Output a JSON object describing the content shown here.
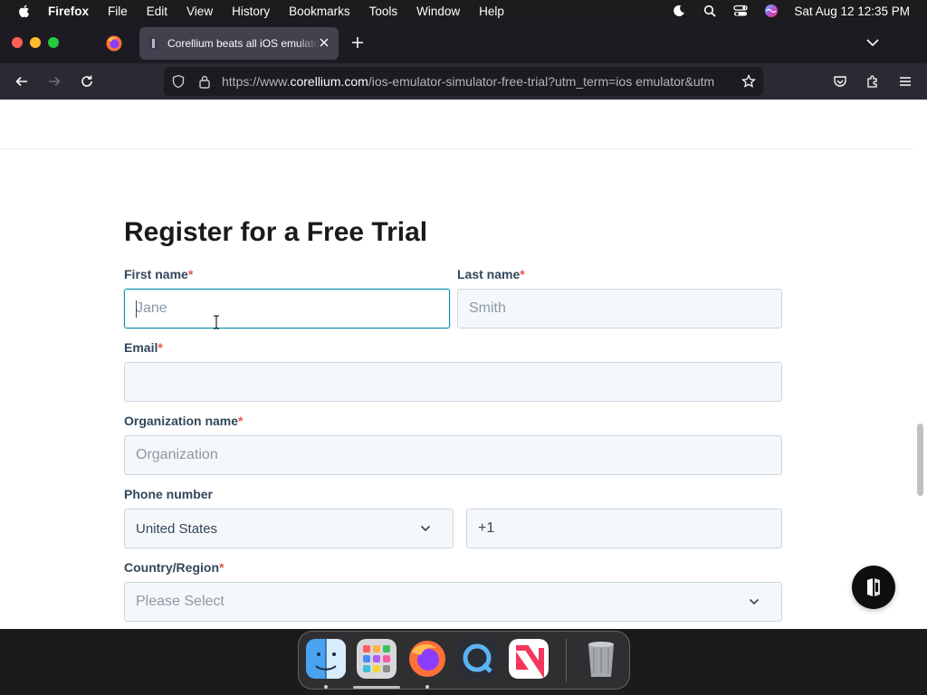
{
  "menubar": {
    "app_name": "Firefox",
    "items": [
      "File",
      "Edit",
      "View",
      "History",
      "Bookmarks",
      "Tools",
      "Window",
      "Help"
    ],
    "clock": "Sat Aug 12  12:35 PM"
  },
  "browser": {
    "tab_title": "Corellium beats all iOS emulators",
    "url_prefix": "https://www.",
    "url_host": "corellium.com",
    "url_path": "/ios-emulator-simulator-free-trial?utm_term=ios emulator&utm"
  },
  "form": {
    "title": "Register for a Free Trial",
    "first_name": {
      "label": "First name",
      "required_mark": "*",
      "placeholder": "Jane"
    },
    "last_name": {
      "label": "Last name",
      "required_mark": "*",
      "placeholder": "Smith"
    },
    "email": {
      "label": "Email",
      "required_mark": "*",
      "placeholder": ""
    },
    "organization": {
      "label": "Organization name",
      "required_mark": "*",
      "placeholder": "Organization"
    },
    "phone": {
      "label": "Phone number",
      "country": "United States",
      "code": "+1"
    },
    "country_region": {
      "label": "Country/Region",
      "required_mark": "*",
      "placeholder": "Please Select"
    }
  },
  "colors": {
    "required": "#e4564c",
    "focus_border": "#0091ae",
    "label": "#33475b"
  },
  "dock": {
    "apps": [
      "finder-icon",
      "launchpad-icon",
      "firefox-icon",
      "quicktime-icon",
      "news-icon",
      "trash-icon"
    ]
  }
}
